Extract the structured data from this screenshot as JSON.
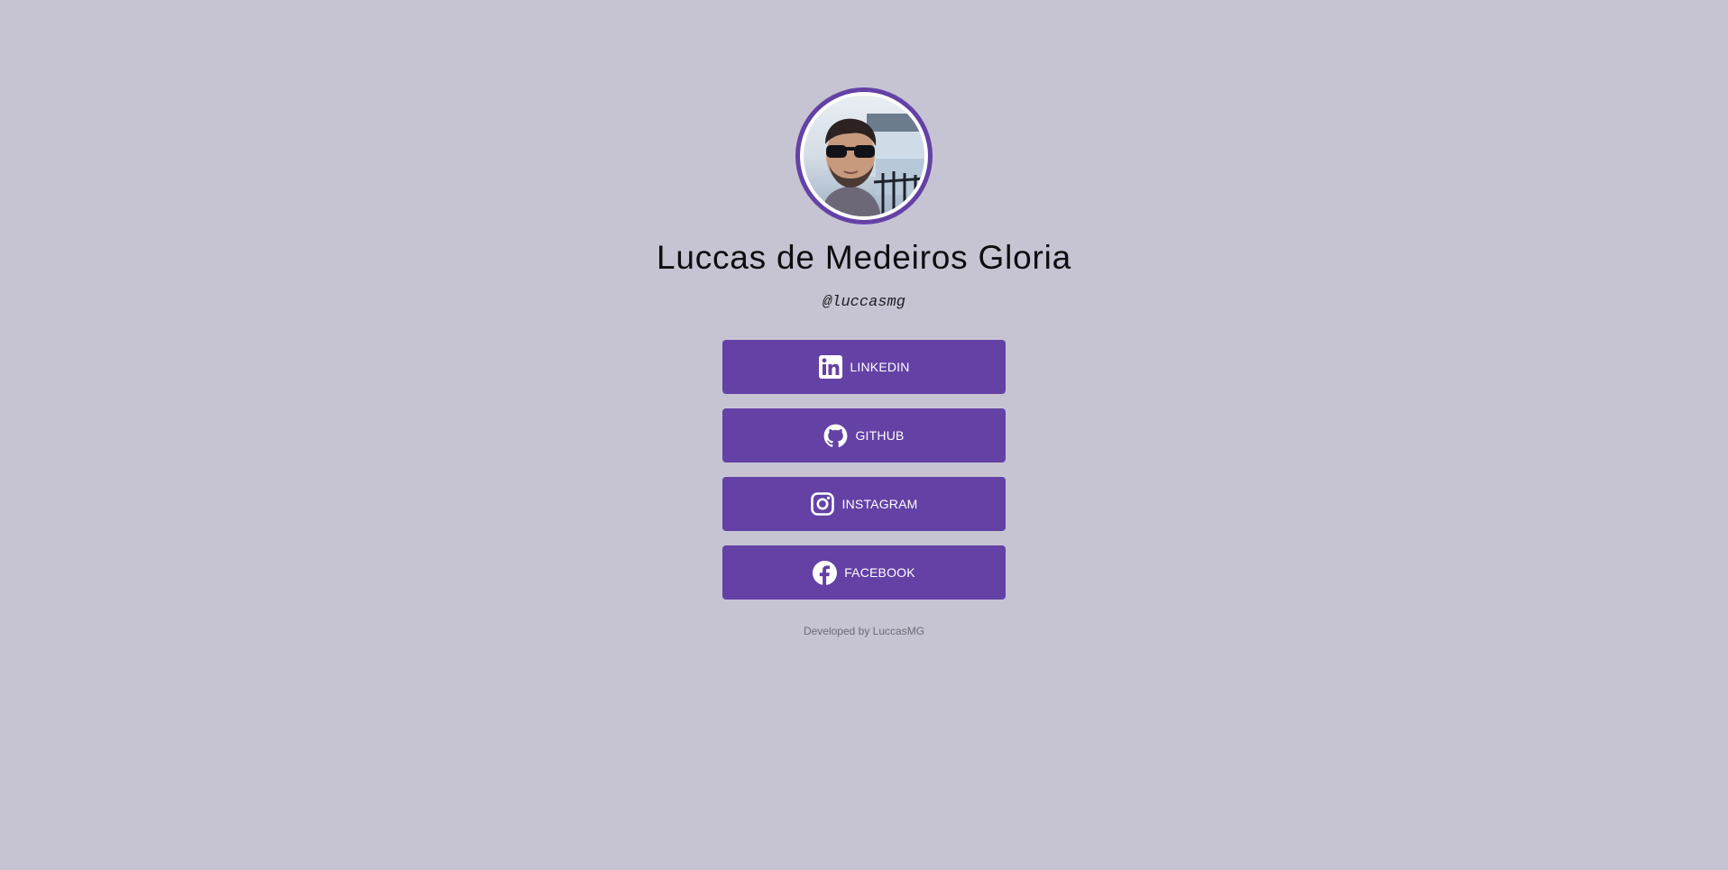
{
  "profile": {
    "name": "Luccas de Medeiros Gloria",
    "handle": "@luccasmg"
  },
  "links": [
    {
      "label": "LINKEDIN",
      "icon": "linkedin-icon"
    },
    {
      "label": "GITHUB",
      "icon": "github-icon"
    },
    {
      "label": "INSTAGRAM",
      "icon": "instagram-icon"
    },
    {
      "label": "FACEBOOK",
      "icon": "facebook-icon"
    }
  ],
  "footer": {
    "text": "Developed by LuccasMG"
  },
  "colors": {
    "background": "#c6c4d2",
    "accent": "#6441a5",
    "button_text": "#ffffff"
  }
}
